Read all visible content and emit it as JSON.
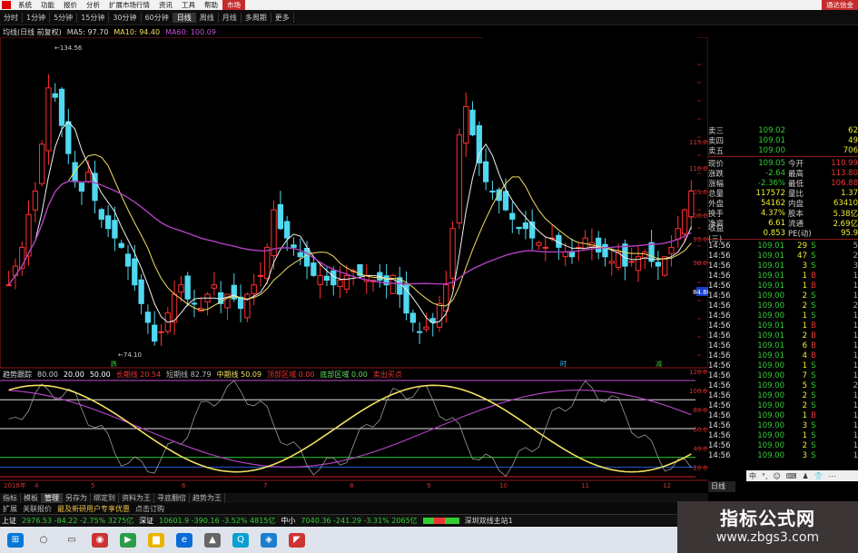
{
  "menubar": {
    "items": [
      "系统",
      "功能",
      "报价",
      "分析",
      "扩展市场行情",
      "资讯",
      "工具",
      "帮助"
    ],
    "tab": "市场",
    "right": "通达信金"
  },
  "periods": {
    "items": [
      "分时",
      "1分钟",
      "5分钟",
      "15分钟",
      "30分钟",
      "60分钟",
      "日线",
      "周线",
      "月线",
      "多周期",
      "更多"
    ],
    "active_index": 6
  },
  "ma_header": {
    "title": "均线(日线 前复权)",
    "ma5": "MA5: 97.70",
    "ma10": "MA10: 94.40",
    "ma60": "MA60: 100.09"
  },
  "price_labels": {
    "high": "134.56",
    "low": "74.10"
  },
  "right_axis_top": [
    "115.0",
    "110.0",
    "105.0",
    "100.0",
    "95.0",
    "90.0"
  ],
  "right_axis_label": "84.80",
  "right_axis_bottom": [
    "120.0",
    "100.0",
    "80.0",
    "60.0",
    "40.0",
    "20.0"
  ],
  "x_axis": [
    "2018年",
    "4",
    "5",
    "6",
    "7",
    "8",
    "9",
    "10",
    "11",
    "12"
  ],
  "chart_markers": {
    "m1": "跌",
    "m2": "时",
    "m3": "减"
  },
  "indicator_header": {
    "title": "趋势跟踪",
    "v1": "80.00",
    "v2": "20.00",
    "v3": "50.00",
    "long": "长期线 20.54",
    "short": "短期线 82.79",
    "mid": "中期线 50.09",
    "t1": "顶部区域 0.00",
    "t2": "底部区域 0.00",
    "t3": "卖出买点"
  },
  "quotes": [
    {
      "label": "卖三",
      "price": "109.02",
      "vol": "62"
    },
    {
      "label": "卖四",
      "price": "109.01",
      "vol": "49"
    },
    {
      "label": "卖五",
      "price": "109.00",
      "vol": "706"
    }
  ],
  "stats": [
    {
      "k1": "现价",
      "v1": "109.05",
      "k2": "今开",
      "v2": "110.99"
    },
    {
      "k1": "涨跌",
      "v1": "-2.64",
      "k2": "最高",
      "v2": "113.80"
    },
    {
      "k1": "涨幅",
      "v1": "-2.36%",
      "k2": "最低",
      "v2": "106.88"
    },
    {
      "k1": "总量",
      "v1": "117572",
      "k2": "量比",
      "v2": "1.37"
    },
    {
      "k1": "外盘",
      "v1": "54162",
      "k2": "内盘",
      "v2": "63410"
    },
    {
      "k1": "换手",
      "v1": "4.37%",
      "k2": "股本",
      "v2": "5.38亿"
    },
    {
      "k1": "净资",
      "v1": "6.61",
      "k2": "流通",
      "v2": "2.69亿"
    },
    {
      "k1": "收益(三)",
      "v1": "0.853",
      "k2": "PE(动)",
      "v2": "95.9"
    }
  ],
  "trades": [
    {
      "t": "14:56",
      "p": "109.01",
      "v": "29",
      "s": "S",
      "n": "5"
    },
    {
      "t": "14:56",
      "p": "109.01",
      "v": "47",
      "s": "S",
      "n": "2"
    },
    {
      "t": "14:56",
      "p": "109.01",
      "v": "3",
      "s": "S",
      "n": "3"
    },
    {
      "t": "14:56",
      "p": "109.01",
      "v": "1",
      "s": "B",
      "n": "1"
    },
    {
      "t": "14:56",
      "p": "109.01",
      "v": "1",
      "s": "B",
      "n": "1"
    },
    {
      "t": "14:56",
      "p": "109.00",
      "v": "2",
      "s": "S",
      "n": "1"
    },
    {
      "t": "14:56",
      "p": "109.00",
      "v": "2",
      "s": "S",
      "n": "2"
    },
    {
      "t": "14:56",
      "p": "109.00",
      "v": "1",
      "s": "S",
      "n": "1"
    },
    {
      "t": "14:56",
      "p": "109.01",
      "v": "1",
      "s": "B",
      "n": "1"
    },
    {
      "t": "14:56",
      "p": "109.01",
      "v": "2",
      "s": "B",
      "n": "1"
    },
    {
      "t": "14:56",
      "p": "109.01",
      "v": "6",
      "s": "B",
      "n": "1"
    },
    {
      "t": "14:56",
      "p": "109.01",
      "v": "4",
      "s": "B",
      "n": "1"
    },
    {
      "t": "14:56",
      "p": "109.00",
      "v": "1",
      "s": "S",
      "n": "1"
    },
    {
      "t": "14:56",
      "p": "109.00",
      "v": "7",
      "s": "S",
      "n": "1"
    },
    {
      "t": "14:56",
      "p": "109.00",
      "v": "5",
      "s": "S",
      "n": "2"
    },
    {
      "t": "14:56",
      "p": "109.00",
      "v": "2",
      "s": "S",
      "n": "1"
    },
    {
      "t": "14:56",
      "p": "109.00",
      "v": "2",
      "s": "S",
      "n": "1"
    },
    {
      "t": "14:56",
      "p": "109.00",
      "v": "1",
      "s": "B",
      "n": "1"
    },
    {
      "t": "14:56",
      "p": "109.00",
      "v": "3",
      "s": "S",
      "n": "1"
    },
    {
      "t": "14:56",
      "p": "109.00",
      "v": "1",
      "s": "S",
      "n": "1"
    },
    {
      "t": "14:56",
      "p": "109.00",
      "v": "2",
      "s": "S",
      "n": "1"
    },
    {
      "t": "14:56",
      "p": "109.00",
      "v": "3",
      "s": "S",
      "n": "1"
    }
  ],
  "ime": {
    "items": [
      "中",
      "°,",
      "☺",
      "⌨",
      "♟",
      "👕",
      "⋯"
    ]
  },
  "ind_tabs": {
    "items": [
      "指标",
      "模板",
      "管理",
      "另存为",
      "绑定到",
      "资料为王",
      "寻底翻倍",
      "趋势为王"
    ],
    "active_index": 2
  },
  "adbar": {
    "items": [
      "扩展",
      "关联报价",
      "最及新研用户专享优惠",
      "点击订购"
    ]
  },
  "right_tab": "日线",
  "status": {
    "sh": "上证",
    "sh_val": "2976.53 -84.22 -2.75% 3275亿",
    "sz": "深证",
    "sz_val": "10601.9 -390.16 -3.52% 4815亿",
    "zx": "中小",
    "zx_val": "7040.36 -241.29 -3.31% 2065亿",
    "right": "深圳双线主站1"
  },
  "watermark": {
    "title": "指标公式网",
    "url": "www.zbgs3.com"
  },
  "colors": {
    "up": "#ff3030",
    "down": "#4fd8f0",
    "ma_white": "#f0f0f0",
    "ma_yellow": "#f0e060",
    "ma_purple": "#b040c0",
    "grid": "#8a1a1a"
  }
}
